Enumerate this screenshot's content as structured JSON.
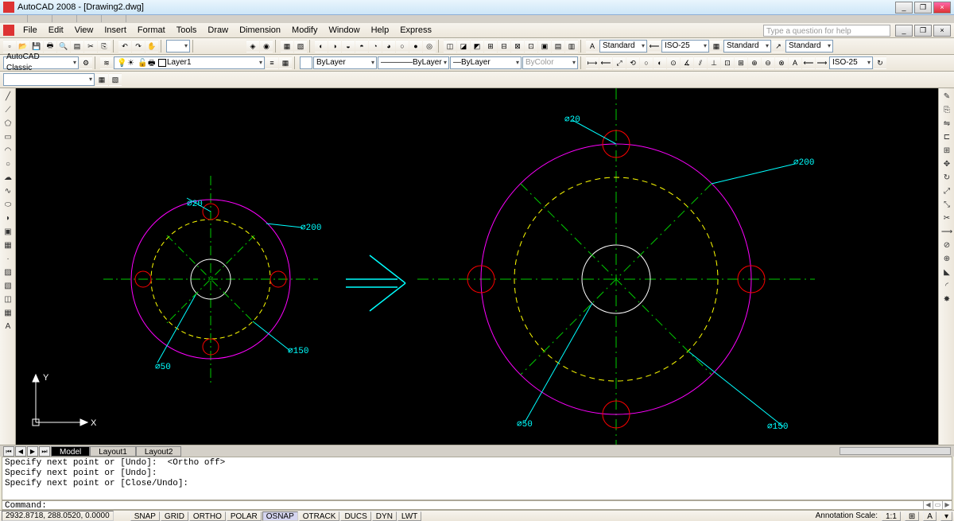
{
  "title": "AutoCAD 2008 - [Drawing2.dwg]",
  "browser_tabs": [
    "",
    "",
    "",
    "",
    "",
    "",
    "",
    "",
    ""
  ],
  "menus": [
    "File",
    "Edit",
    "View",
    "Insert",
    "Format",
    "Tools",
    "Draw",
    "Dimension",
    "Modify",
    "Window",
    "Help",
    "Express"
  ],
  "help_placeholder": "Type a question for help",
  "row1": {
    "text_style": "Standard",
    "dim_style": "ISO-25",
    "table_style": "Standard",
    "mleader_style": "Standard"
  },
  "row2": {
    "workspace": "AutoCAD Classic",
    "layer": "Layer1",
    "linetype": "ByLayer",
    "lineweight": "ByLayer",
    "plot_style": "ByLayer",
    "color_label": "ByColor",
    "dim_style": "ISO-25"
  },
  "model_tabs": {
    "active": "Model",
    "others": [
      "Layout1",
      "Layout2"
    ]
  },
  "cmd_lines": [
    "Specify next point or [Undo]:  <Ortho off>",
    "Specify next point or [Undo]:",
    "Specify next point or [Close/Undo]:"
  ],
  "cmd_prompt": "Command:",
  "status": {
    "coords": "2932.8718, 288.0520, 0.0000",
    "buttons": [
      "SNAP",
      "GRID",
      "ORTHO",
      "POLAR",
      "OSNAP",
      "OTRACK",
      "DUCS",
      "DYN",
      "LWT"
    ],
    "active": [
      "OSNAP"
    ],
    "anno_label": "Annotation Scale:",
    "anno_value": "1:1"
  },
  "drawing": {
    "labels": {
      "left": {
        "d20": "⌀20",
        "d200": "⌀200",
        "d50": "⌀50",
        "d150": "⌀150"
      },
      "right": {
        "d20": "⌀20",
        "d200": "⌀200",
        "d50": "⌀50",
        "d150": "⌀150"
      }
    },
    "ucs": {
      "x": "X",
      "y": "Y"
    }
  },
  "colors": {
    "magenta": "#f0f",
    "yellow": "#ff0",
    "cyan": "#0ff",
    "green": "#0c0",
    "red": "#f00",
    "white": "#fff"
  }
}
